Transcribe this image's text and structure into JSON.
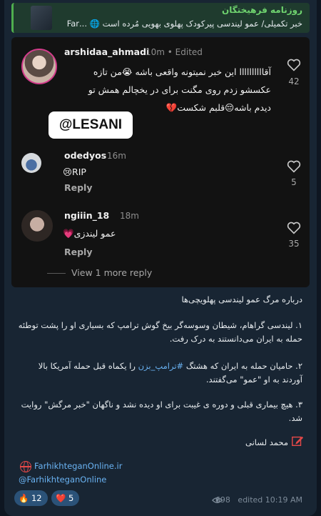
{
  "reply": {
    "title": "روزنامه فرهیختگان",
    "text": "خبر تکمیلی/ عمو لیندسی پیرکودک پهلوی بهویی مُرده است 🌐 ...Far"
  },
  "comments": [
    {
      "username": "arshidaa_ahmadi",
      "time": "10m • Edited",
      "lines": [
        "آقاااااااااا این خبر نمیتونه واقعی باشه 😭من تازه",
        "عکسشو زدم روی  مگنت  برای در یخچالم همش تو",
        "دیدم باشه😔قلبم شکست💔"
      ],
      "likes": "42"
    },
    {
      "username": "odedyos",
      "time": "16m",
      "text": "😢RIP",
      "reply_label": "Reply",
      "likes": "5"
    },
    {
      "username": "ngiiin_18",
      "time": "18m",
      "text": "عمو لیندزی💗",
      "reply_label": "Reply",
      "likes": "35"
    }
  ],
  "sticker_text": "@LESANI",
  "view_more": "View 1 more reply",
  "body": {
    "heading": "درباره مرگ عمو لیندسی پهلویچی‌ها",
    "p1": "۱. لیندسی گراهام، شیطان وسوسه‌گر بیخ گوش ترامپ که بسیاری او را پشت توطئه حمله به ایران می‌دانستند به درک رفت.",
    "p2_before": "۲. حامیان حمله به ایران که هشتگ ",
    "p2_hashtag": "#ترامپ_بزن",
    "p2_after": " را یکماه قبل حمله آمریکا بالا آوردند به او \"عمو\" می‌گفتند.",
    "p3": "۳. هیچ بیماری قبلی و دوره ی غیبت برای او دیده نشد و ناگهان \"خبر مرگش\" روایت شد.",
    "author": "محمد لسانی"
  },
  "footer": {
    "website": "FarhikhteganOnline.ir",
    "handle": "@FarhikhteganOnline"
  },
  "reactions": [
    {
      "emoji": "🔥",
      "count": "12"
    },
    {
      "emoji": "❤️",
      "count": "5"
    }
  ],
  "meta": {
    "views": "698",
    "status": "edited 10:19 AM"
  },
  "colors": {
    "background": "#0e1621",
    "bubble": "#182533",
    "link": "#6ab3f3",
    "reply_accent": "#4fae4e"
  }
}
